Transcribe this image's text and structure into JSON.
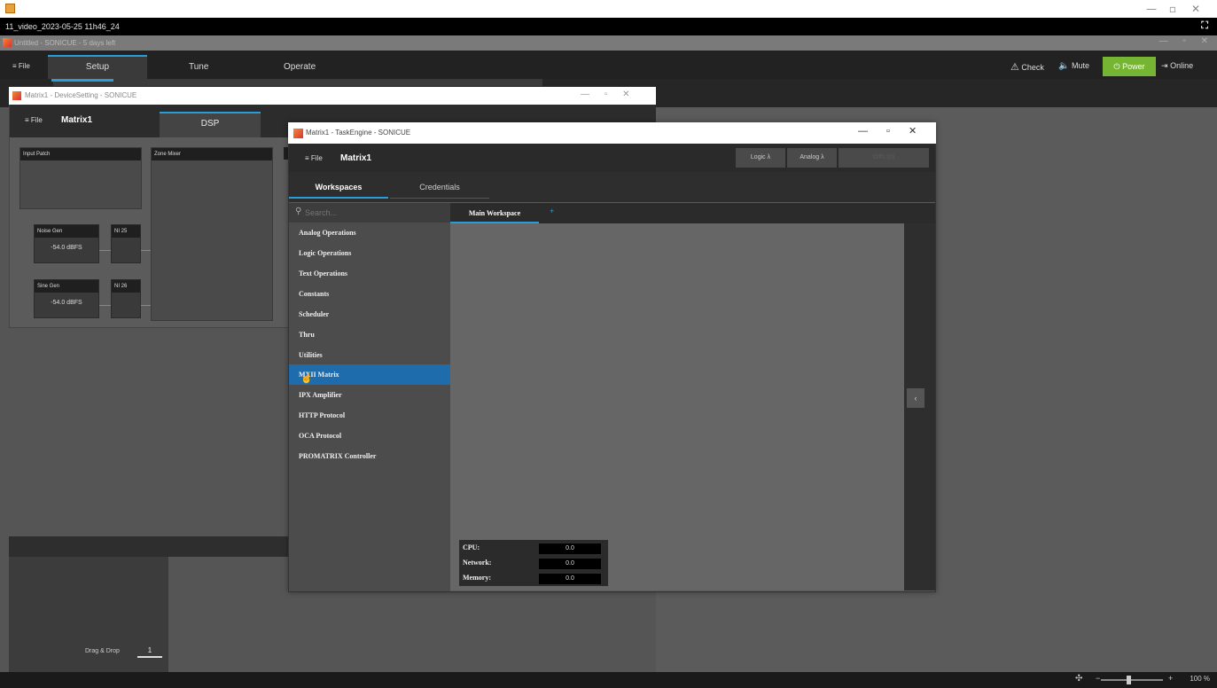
{
  "player": {
    "title": "11_video_2023-05-25 11h46_24"
  },
  "app": {
    "title": "Untitled - SONICUE - 5 days left"
  },
  "main_menu": {
    "file": "≡ File",
    "tabs": [
      "Setup",
      "Tune",
      "Operate"
    ],
    "check": "Check",
    "mute": "Mute",
    "power": "Power",
    "online": "Online"
  },
  "device_setting": {
    "title": "Matrix1 - DeviceSetting - SONICUE",
    "menu": "≡ File",
    "name": "Matrix1",
    "tab": "DSP",
    "input_patch": "Input Patch",
    "zone_mixer": "Zone Mixer",
    "noise_gen": {
      "label": "Noise Gen",
      "value": "-54.0 dBFS",
      "port": "NI 25"
    },
    "sine_gen": {
      "label": "Sine Gen",
      "value": "-54.0 dBFS",
      "port": "NI 26"
    }
  },
  "drag": {
    "label": "Drag & Drop",
    "value": "1"
  },
  "zoom": {
    "value": "100 %"
  },
  "task_engine": {
    "title": "Matrix1 - TaskEngine - SONICUE",
    "menu": "≡ File",
    "name": "Matrix1",
    "tool_buttons": [
      "Logic λ",
      "Analog λ",
      "Diffs (0)"
    ],
    "tabs": {
      "workspaces": "Workspaces",
      "credentials": "Credentials"
    },
    "search_placeholder": "Search...",
    "categories": [
      "Analog Operations",
      "Logic Operations",
      "Text Operations",
      "Constants",
      "Scheduler",
      "Thru",
      "Utilities",
      "MXII Matrix",
      "IPX Amplifier",
      "HTTP Protocol",
      "OCA Protocol",
      "PROMATRIX Controller"
    ],
    "selected_category": "MXII Matrix",
    "workspace_tab": "Main Workspace",
    "stats": [
      {
        "label": "CPU:",
        "value": "0.0"
      },
      {
        "label": "Network:",
        "value": "0.0"
      },
      {
        "label": "Memory:",
        "value": "0.0"
      }
    ]
  },
  "colors": {
    "accent": "#2a9cd8",
    "power": "#76b534",
    "selected": "#1f6cad"
  }
}
